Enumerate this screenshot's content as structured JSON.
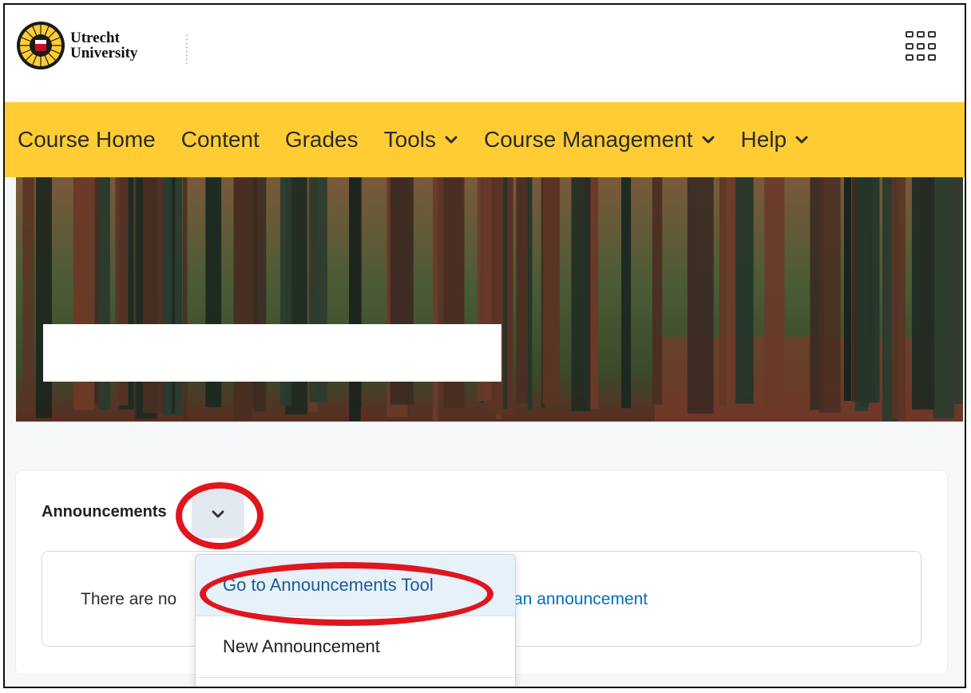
{
  "header": {
    "logo_line1": "Utrecht",
    "logo_line2": "University",
    "apps_icon": "waffle-grid-icon"
  },
  "nav": {
    "items": [
      {
        "label": "Course Home",
        "dropdown": false
      },
      {
        "label": "Content",
        "dropdown": false
      },
      {
        "label": "Grades",
        "dropdown": false
      },
      {
        "label": "Tools",
        "dropdown": true
      },
      {
        "label": "Course Management",
        "dropdown": true
      },
      {
        "label": "Help",
        "dropdown": true
      }
    ]
  },
  "banner": {
    "image": "forest-banner-image"
  },
  "announcements": {
    "title": "Announcements",
    "notice_prefix": "There are no",
    "notice_link": "an announcement",
    "menu": {
      "item_1": "Go to Announcements Tool",
      "item_2": "New Announcement"
    }
  },
  "colors": {
    "nav_bg": "#ffcd33",
    "link": "#006fbf",
    "highlight_ring": "#e0161e"
  }
}
